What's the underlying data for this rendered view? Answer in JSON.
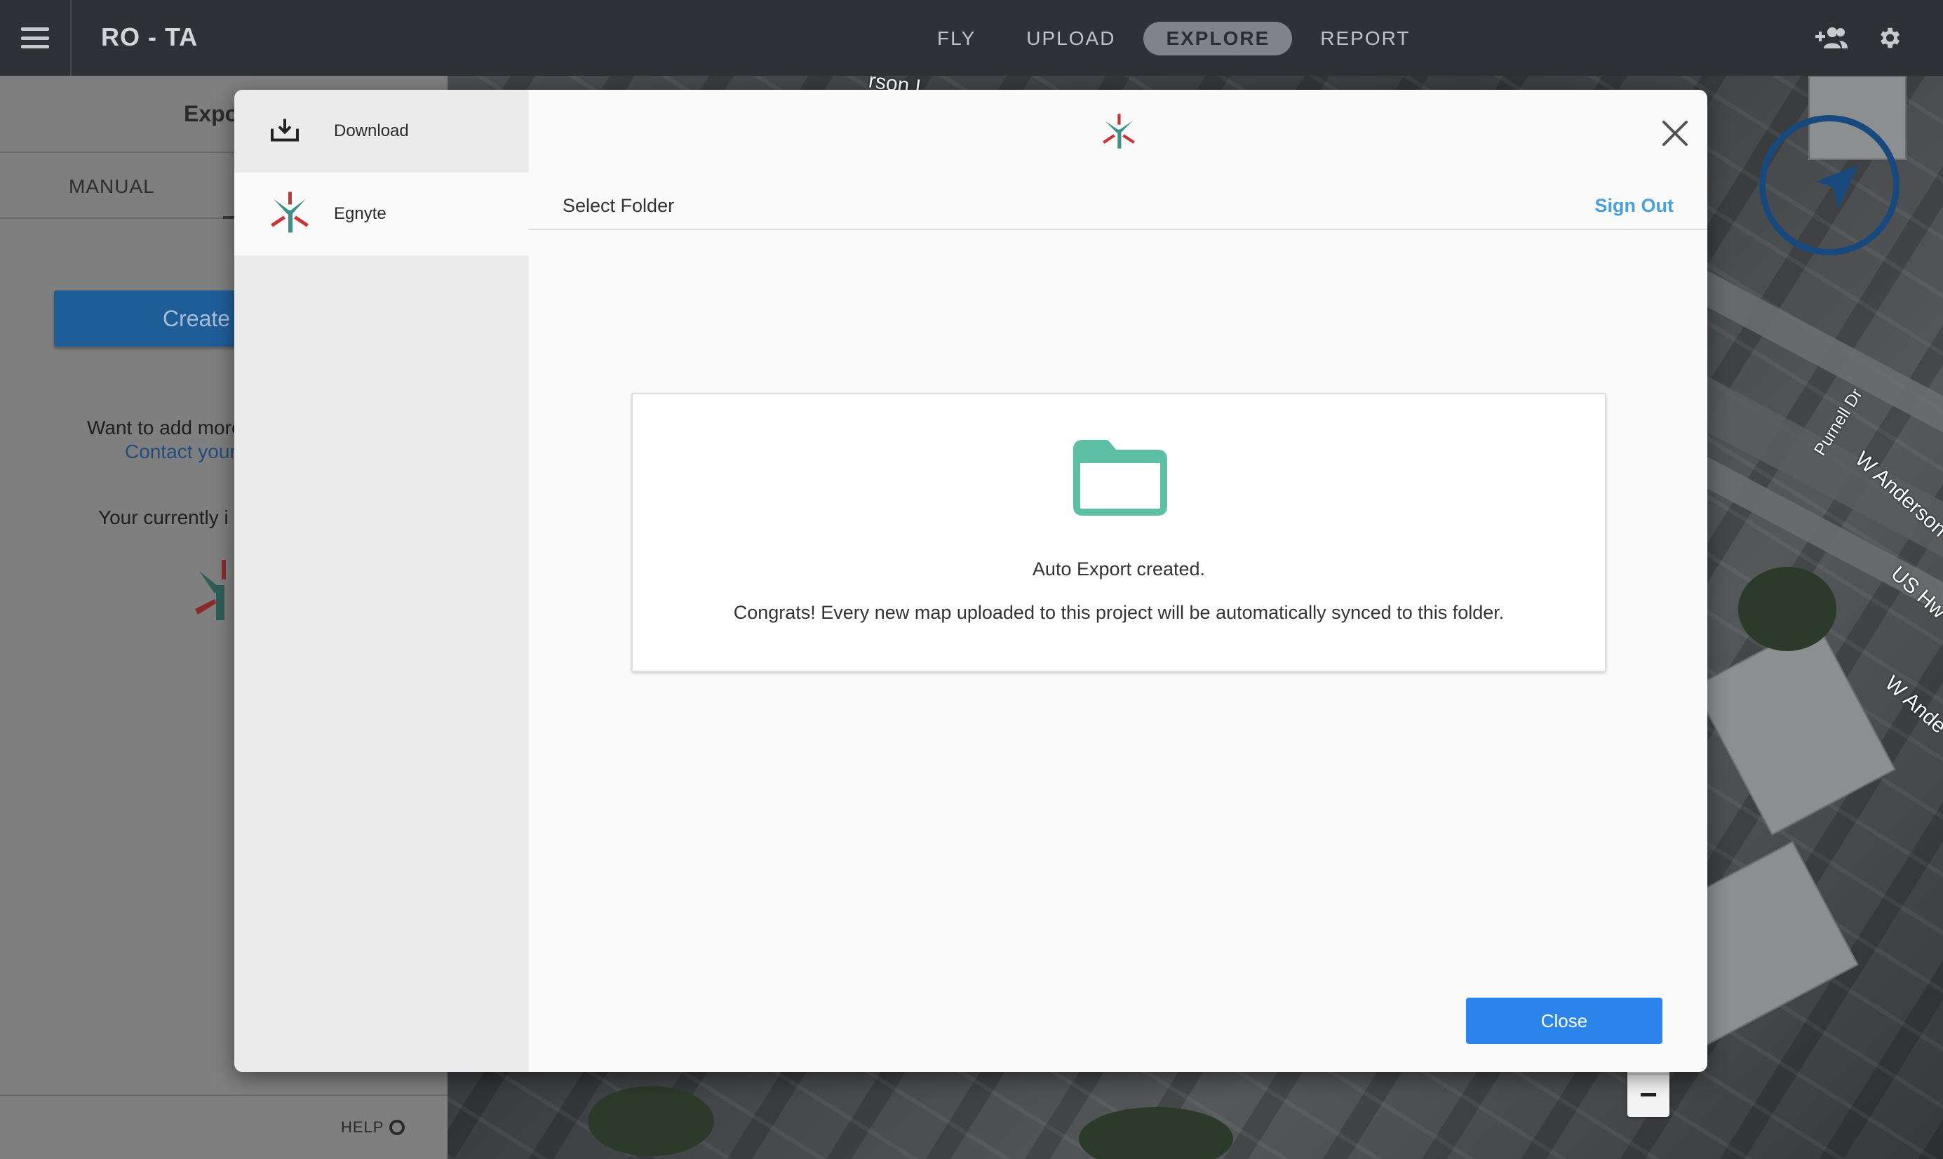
{
  "header": {
    "app_title": "RO - TA",
    "nav": [
      {
        "label": "FLY"
      },
      {
        "label": "UPLOAD"
      },
      {
        "label": "EXPLORE",
        "active": true
      },
      {
        "label": "REPORT"
      }
    ],
    "icons": [
      "hamburger-menu-icon",
      "add-user-icon",
      "gear-icon"
    ]
  },
  "left_panel": {
    "title": "Expo",
    "tab_manual": "MANUAL",
    "create_button": "Create",
    "want_more_text": "Want to add more",
    "contact_link": "Contact your",
    "currently_text": "Your currently i",
    "help_label": "HELP"
  },
  "map": {
    "labels": [
      "rson L",
      "Purnell Dr",
      "W Anderson",
      "US Hw",
      "W Ande"
    ]
  },
  "modal": {
    "side_items": [
      {
        "label": "Download",
        "icon": "download-icon"
      },
      {
        "label": "Egnyte",
        "icon": "egnyte-logo-icon",
        "active": true
      }
    ],
    "select_folder_label": "Select Folder",
    "sign_out_label": "Sign Out",
    "success_title": "Auto Export created.",
    "success_message": "Congrats! Every new map uploaded to this project will be automatically synced to this folder.",
    "close_button_label": "Close"
  },
  "colors": {
    "accent_blue": "#2b84ea",
    "link_blue": "#4a9fe0",
    "folder_teal": "#5dbfa4",
    "egnyte_teal": "#3d8f87",
    "egnyte_red": "#c8363a",
    "topbar": "#2e3236"
  }
}
